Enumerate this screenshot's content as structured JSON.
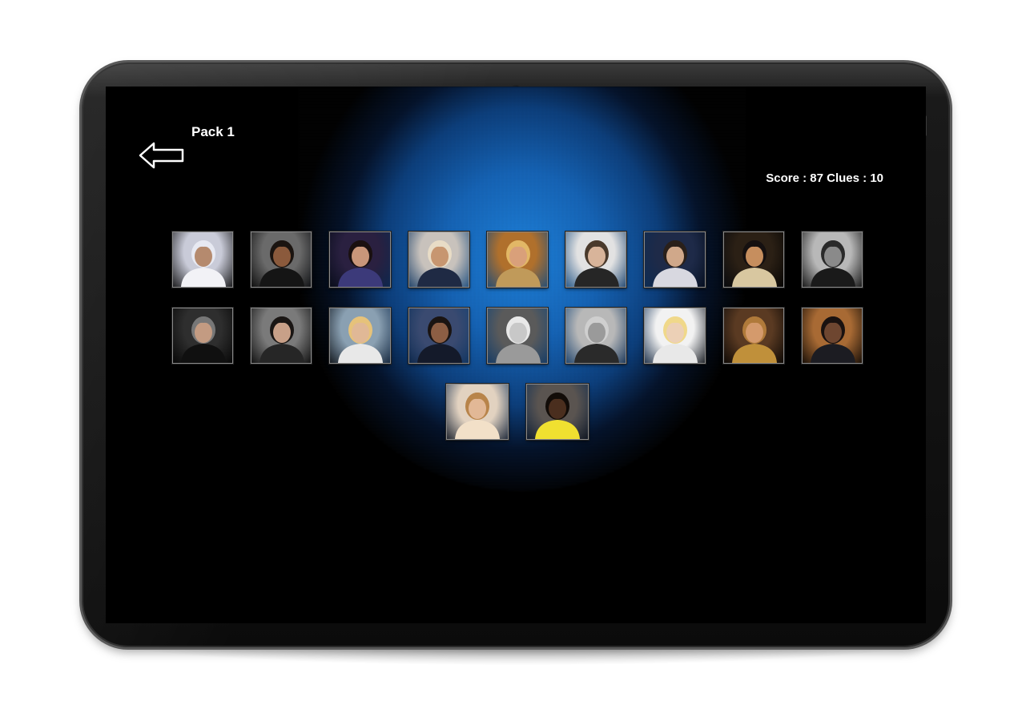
{
  "header": {
    "title": "Pack 1",
    "score_label": "Score : ",
    "score_value": "87",
    "clues_label": " Clues : ",
    "clues_value": "10",
    "back_icon": "back-arrow-icon"
  },
  "colors": {
    "spotlight": "#1c7fd8",
    "bezel": "#0b0b0b",
    "text": "#ffffff"
  },
  "tiles": [
    {
      "subject": "woman in white-blue headscarf",
      "bg": "#c9cbd8",
      "skin": "#b58a6e",
      "hair": "#e7e9f2",
      "cloth": "#f2f2f6",
      "bw": false
    },
    {
      "subject": "man in black jacket",
      "bg": "#6a6a6a",
      "skin": "#8b5a3c",
      "hair": "#1b1410",
      "cloth": "#151515",
      "bw": false
    },
    {
      "subject": "performer on dark purple stage",
      "bg": "#2a2040",
      "skin": "#c9967a",
      "hair": "#1a1010",
      "cloth": "#3c3a7a",
      "bw": false
    },
    {
      "subject": "man in cowboy hat",
      "bg": "#c8c2bc",
      "skin": "#c79670",
      "hair": "#e8dcc6",
      "cloth": "#1f2a44",
      "bw": false
    },
    {
      "subject": "blonde woman",
      "bg": "#b0702c",
      "skin": "#d9a07a",
      "hair": "#e2b766",
      "cloth": "#c09a5a",
      "bw": false
    },
    {
      "subject": "man in dark hoodie",
      "bg": "#e2e2e2",
      "skin": "#d8b49a",
      "hair": "#4a3a2c",
      "cloth": "#262626",
      "bw": false
    },
    {
      "subject": "performer on stage with light",
      "bg": "#1e2a48",
      "skin": "#d0a88a",
      "hair": "#2a201a",
      "cloth": "#d8d8e0",
      "bw": false
    },
    {
      "subject": "shirtless fighter",
      "bg": "#2b2015",
      "skin": "#c68e5e",
      "hair": "#151010",
      "cloth": "#d8c7a0",
      "bw": false
    },
    {
      "subject": "bearded man black and white",
      "bg": "#b8b8b8",
      "skin": "#8a8a8a",
      "hair": "#2a2a2a",
      "cloth": "#1a1a1a",
      "bw": true
    },
    {
      "subject": "older man in black",
      "bg": "#2e2e2e",
      "skin": "#c39b82",
      "hair": "#777777",
      "cloth": "#101010",
      "bw": false
    },
    {
      "subject": "man in dark jacket",
      "bg": "#7a7a7a",
      "skin": "#c8a088",
      "hair": "#1a1614",
      "cloth": "#262626",
      "bw": false
    },
    {
      "subject": "woman with hat singing",
      "bg": "#8aa0b2",
      "skin": "#e0b896",
      "hair": "#e6c27a",
      "cloth": "#e8e8e8",
      "bw": false
    },
    {
      "subject": "man at podium with flags",
      "bg": "#3a4a70",
      "skin": "#8c5e44",
      "hair": "#1a1412",
      "cloth": "#141a2a",
      "bw": false
    },
    {
      "subject": "woman black and white portrait",
      "bg": "#5a5a5a",
      "skin": "#c8c8c8",
      "hair": "#e8e8e8",
      "cloth": "#9a9a9a",
      "bw": true
    },
    {
      "subject": "man black and white",
      "bg": "#b8b8b8",
      "skin": "#9a9a9a",
      "hair": "#cfcfcf",
      "cloth": "#2a2a2a",
      "bw": true
    },
    {
      "subject": "blonde young woman",
      "bg": "#f2f2f2",
      "skin": "#ecd0b6",
      "hair": "#f0d88a",
      "cloth": "#e8e8e8",
      "bw": false
    },
    {
      "subject": "woman singing",
      "bg": "#5a3a22",
      "skin": "#d49a6c",
      "hair": "#b07a3a",
      "cloth": "#c0903a",
      "bw": false
    },
    {
      "subject": "man in suit",
      "bg": "#a86a34",
      "skin": "#6e4630",
      "hair": "#1a1210",
      "cloth": "#1c1c22",
      "bw": false
    },
    {
      "subject": "woman with long hair",
      "bg": "#e2d2c0",
      "skin": "#e2b896",
      "hair": "#b8844a",
      "cloth": "#f2e0c8",
      "bw": false
    },
    {
      "subject": "sprinter in yellow",
      "bg": "#5a5450",
      "skin": "#4a2e1e",
      "hair": "#120c08",
      "cloth": "#f0e030",
      "bw": false
    }
  ]
}
